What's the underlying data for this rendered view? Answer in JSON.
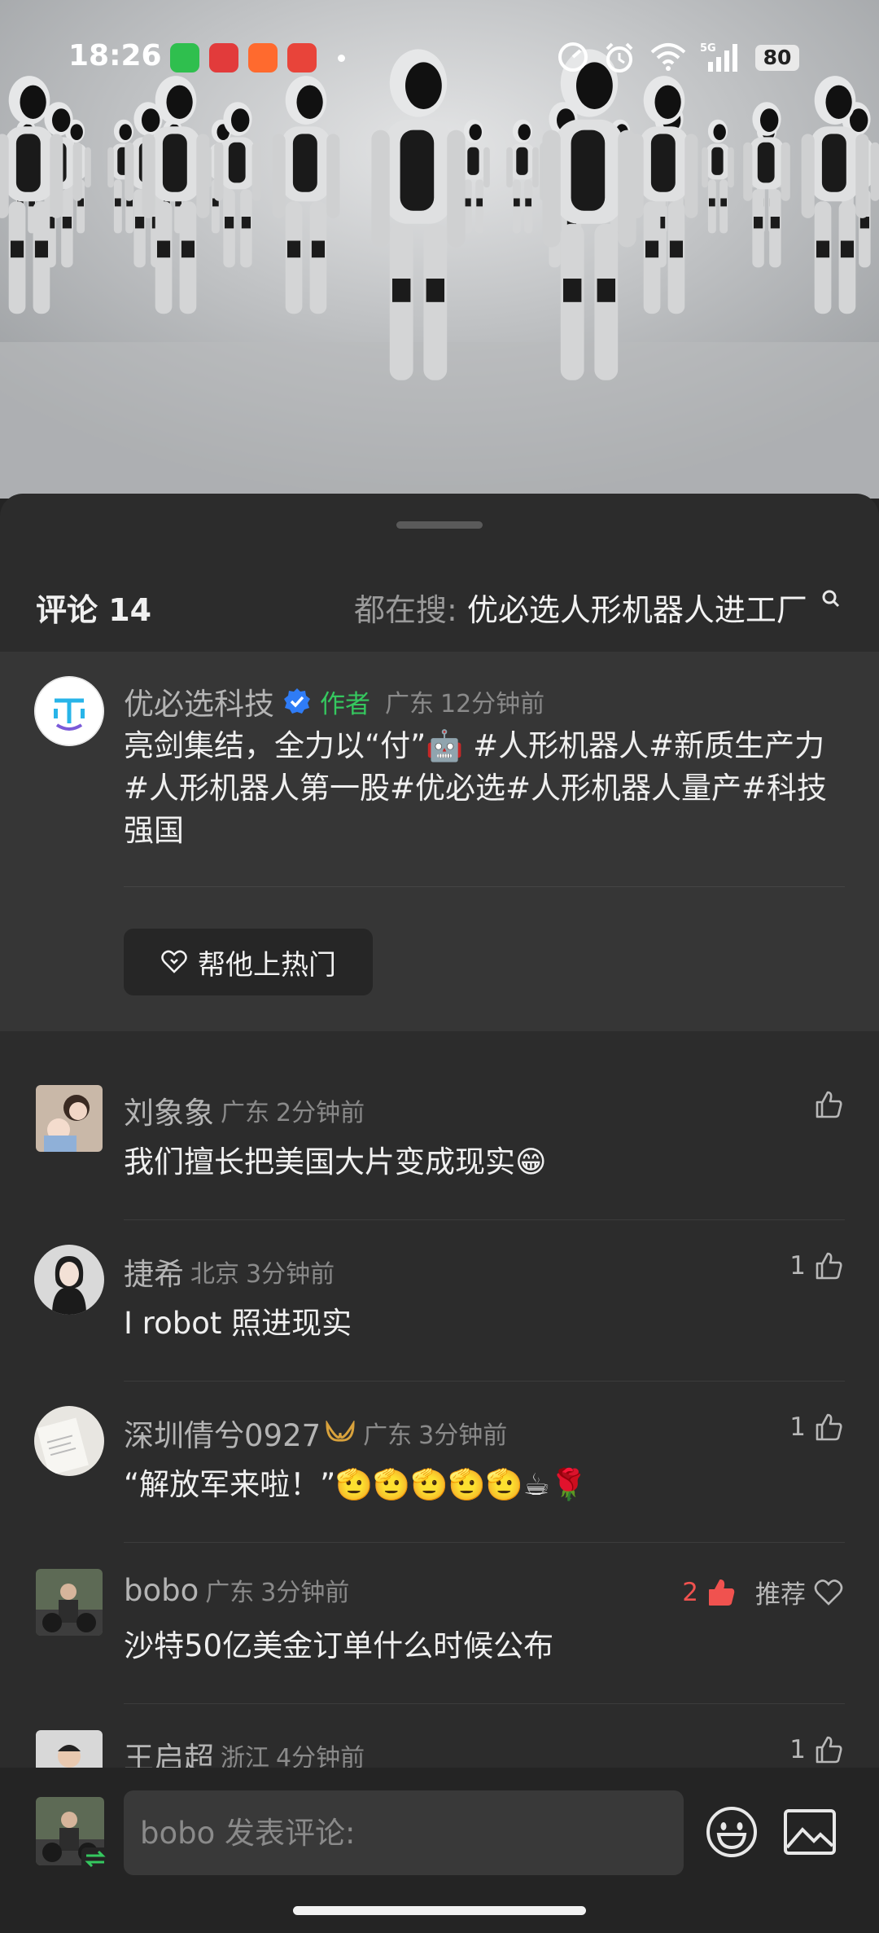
{
  "status_bar": {
    "time": "18:26",
    "battery": "80"
  },
  "comments_header": {
    "title": "评论 14",
    "search_prefix": "都在搜:",
    "search_term": "优必选人形机器人进工厂"
  },
  "author_comment": {
    "name": "优必选科技",
    "tag": "作者",
    "location": "广东",
    "time": "12分钟前",
    "text": "亮剑集结，全力以“付”🤖 #人形机器人#新质生产力#人形机器人第一股#优必选#人形机器人量产#科技强国",
    "boost_label": "帮他上热门"
  },
  "comments": [
    {
      "name": "刘象象",
      "location": "广东",
      "time": "2分钟前",
      "text": "我们擅长把美国大片变成现实😁",
      "likes": ""
    },
    {
      "name": "捷希",
      "location": "北京",
      "time": "3分钟前",
      "text": "I robot 照进现实",
      "likes": "1"
    },
    {
      "name": "深圳倩兮0927",
      "location": "广东",
      "time": "3分钟前",
      "text": "“解放军来啦！”🫡🫡🫡🫡🫡☕🌹",
      "likes": "1"
    },
    {
      "name": "bobo",
      "location": "广东",
      "time": "3分钟前",
      "text": "沙特50亿美金订单什么时候公布",
      "likes": "2",
      "recommend": "推荐"
    },
    {
      "name": "王启超",
      "location": "浙江",
      "time": "4分钟前",
      "text": "",
      "likes": "1"
    }
  ],
  "input": {
    "placeholder": "bobo 发表评论:"
  },
  "colors": {
    "background": "#2c2c2c",
    "author_block": "#363636",
    "author_tag": "#35c85f",
    "liked": "#f0524f"
  }
}
